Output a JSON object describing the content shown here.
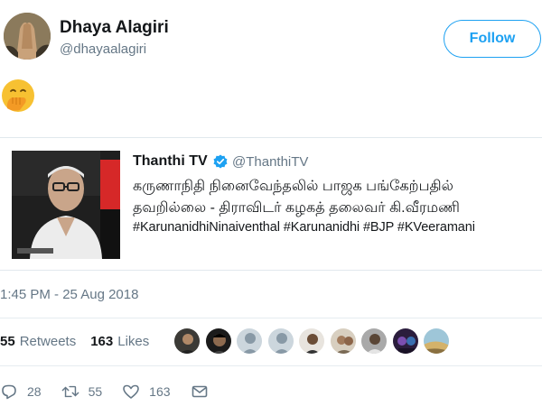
{
  "author": {
    "name": "Dhaya Alagiri",
    "handle": "@dhayaalagiri",
    "follow_label": "Follow"
  },
  "tweet": {
    "emoji_icon": "face-with-hand-over-mouth-icon"
  },
  "quoted": {
    "name": "Thanthi TV",
    "handle": "@ThanthiTV",
    "line1": "கருணாநிதி நினைவேந்தலில் பாஜக பங்கேற்பதில்",
    "line2": "தவறில்லை - திராவிடர் கழகத் தலைவர் கி.வீரமணி",
    "hashtags": "#KarunanidhiNinaiventhal #Karunanidhi #BJP #KVeeramani"
  },
  "timestamp": "1:45 PM - 25 Aug 2018",
  "stats": {
    "retweets_count": "55",
    "retweets_label": "Retweets",
    "likes_count": "163",
    "likes_label": "Likes"
  },
  "actions": {
    "reply_count": "28",
    "retweet_count": "55",
    "like_count": "163"
  },
  "colors": {
    "accent": "#1da1f2",
    "secondary_text": "#657786",
    "primary_text": "#14171a",
    "border": "#e1e8ed"
  }
}
